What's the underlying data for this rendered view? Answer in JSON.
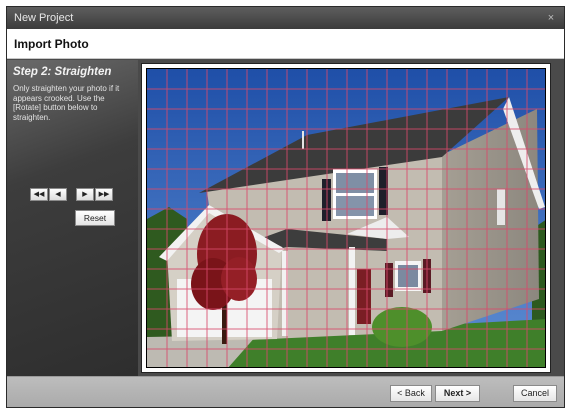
{
  "window": {
    "title": "New Project",
    "close_glyph": "×"
  },
  "header": {
    "title": "Import Photo"
  },
  "step": {
    "title": "Step 2:  Straighten",
    "description": "Only straighten your photo if it appears crooked.  Use the [Rotate] button below to straighten."
  },
  "controls": {
    "rotate_left_fast": "◀◀",
    "rotate_left": "◀",
    "rotate_right": "▶",
    "rotate_right_fast": "▶▶",
    "reset_label": "Reset"
  },
  "footer": {
    "back_label": "< Back",
    "next_label": "Next >",
    "cancel_label": "Cancel"
  },
  "colors": {
    "grid_line": "#d94a6b",
    "sky": "#2f5fb2",
    "siding": "#b9b2a6",
    "roof": "#3d3d3d",
    "lawn": "#3f7f2a",
    "tree": "#8b1c22"
  },
  "icons": {
    "photo": "house-photo"
  }
}
